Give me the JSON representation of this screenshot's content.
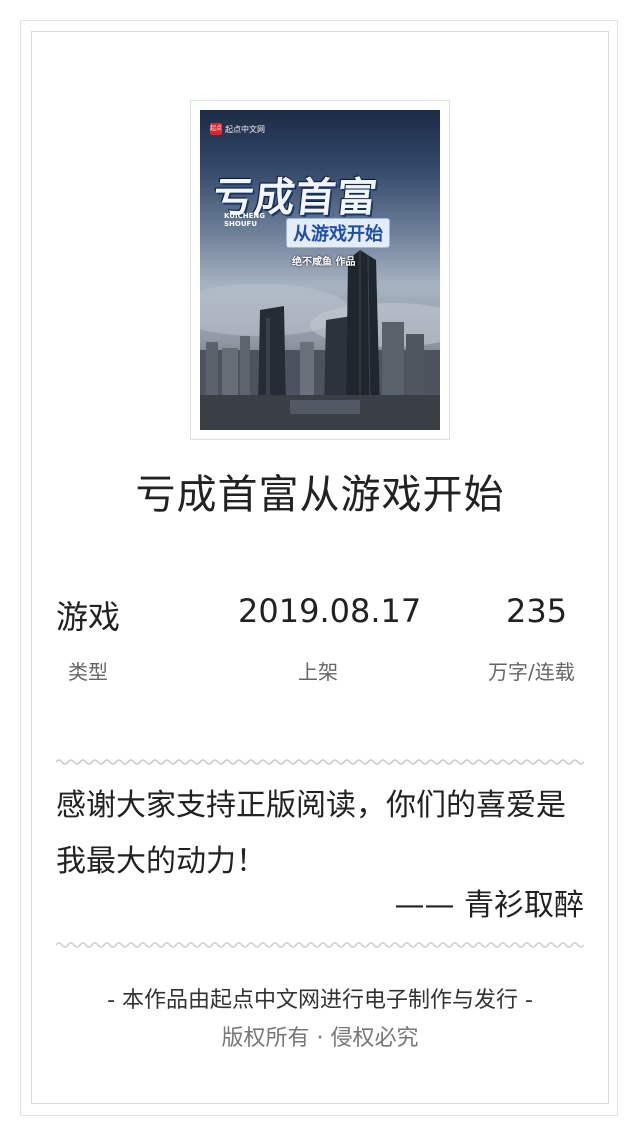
{
  "cover": {
    "brand_mark": "起点",
    "brand_name": "起点中文网",
    "title_art": "亏成首富",
    "pinyin_line1": "KUICHENG",
    "pinyin_line2": "SHOUFU",
    "subtitle_art": "从游戏开始",
    "author_art": "绝不咸鱼 作品"
  },
  "book": {
    "title": "亏成首富从游戏开始"
  },
  "stats": [
    {
      "value": "游戏",
      "label": "类型"
    },
    {
      "value": "2019.08.17",
      "label": "上架"
    },
    {
      "value": "235",
      "label": "万字/连载"
    }
  ],
  "quote": {
    "text": "感谢大家支持正版阅读，你们的喜爱是我最大的动力！",
    "signature": "—— 青衫取醉"
  },
  "footer": {
    "publisher_line": "- 本作品由起点中文网进行电子制作与发行 -",
    "rights_line": "版权所有 · 侵权必究"
  }
}
